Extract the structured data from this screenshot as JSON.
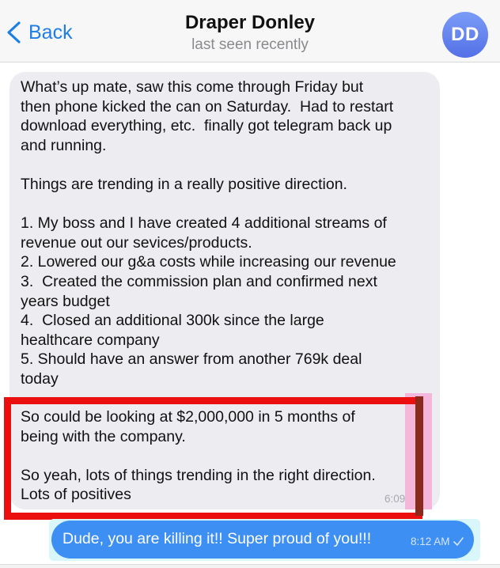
{
  "header": {
    "back_label": "Back",
    "contact_name": "Draper Donley",
    "status": "last seen recently",
    "avatar_initials": "DD",
    "accent_color": "#1f7de6"
  },
  "incoming_message": {
    "text_part1": "What’s up mate, saw this come through Friday but\nthen phone kicked the can on Saturday.  Had to restart\ndownload everything, etc.  finally got telegram back up\nand running.\n\nThings are trending in a really positive direction.\n\n1. My boss and I have created 4 additional streams of\nrevenue out our sevices/products.\n2. Lowered our g&a costs while increasing our revenue\n3.  Created the commission plan and confirmed next\nyears budget\n4.  Closed an additional 300k since the large\nhealthcare company\n5. Should have an answer from another 769k deal\ntoday",
    "text_part2": "So could be looking at $2,000,000 in 5 months of\nbeing with the company.\n\nSo yeah, lots of things trending in the right direction.\nLots of positives",
    "time": "6:09 AM"
  },
  "outgoing_message": {
    "text": "Dude, you are killing it!! Super proud of you!!!",
    "time": "8:12 AM"
  },
  "highlight": {
    "border_color": "#ec0f0f"
  }
}
